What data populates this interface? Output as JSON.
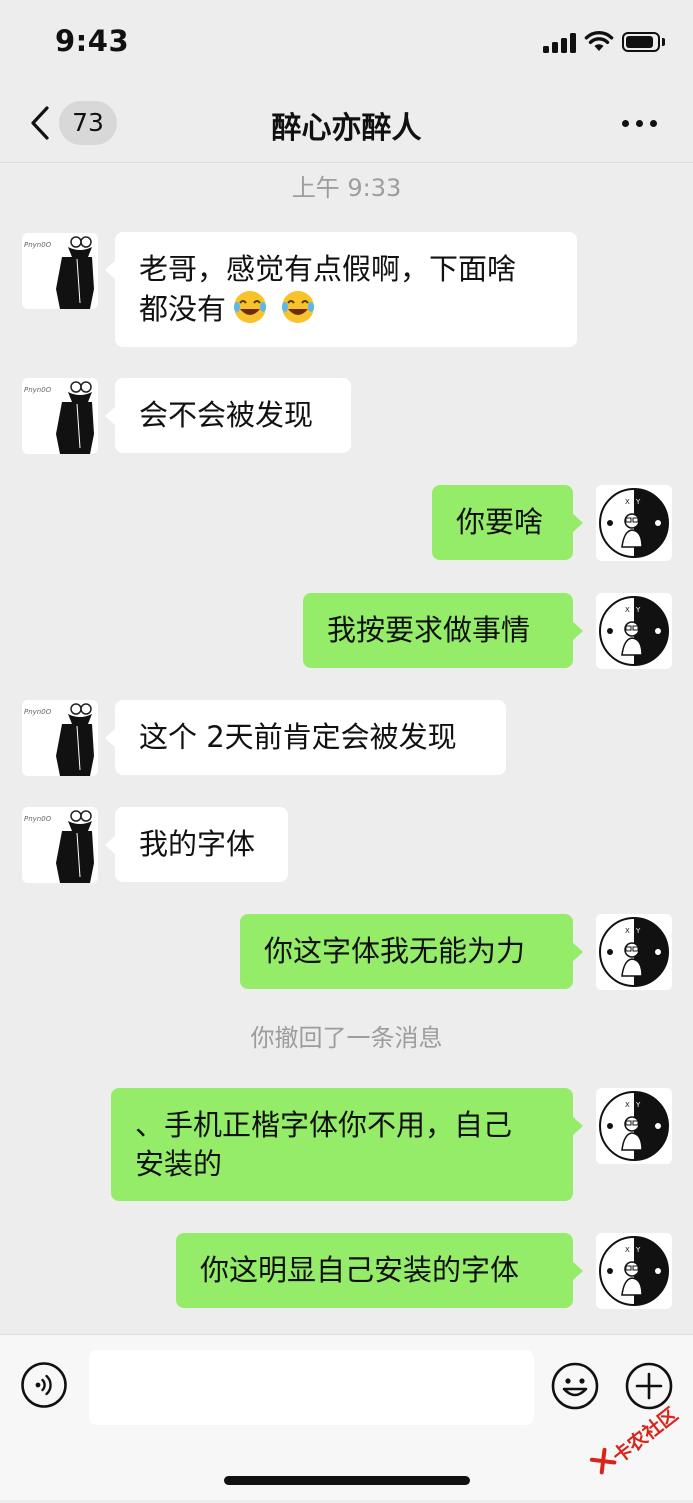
{
  "status_bar": {
    "time": "9:43"
  },
  "nav": {
    "unread_count": "73",
    "title": "醉心亦醉人"
  },
  "messages": [
    {
      "kind": "time",
      "text": "上午 9:33"
    },
    {
      "kind": "in",
      "text": "老哥，感觉有点假啊，下面啥",
      "text_line2": "都没有",
      "emojis": [
        "face-with-tears-of-joy",
        "face-with-tears-of-joy"
      ]
    },
    {
      "kind": "in",
      "text": "会不会被发现"
    },
    {
      "kind": "out",
      "text": "你要啥"
    },
    {
      "kind": "out",
      "text": "我按要求做事情"
    },
    {
      "kind": "in",
      "text": "这个 2天前肯定会被发现"
    },
    {
      "kind": "in",
      "text": "我的字体"
    },
    {
      "kind": "out",
      "text": "你这字体我无能为力"
    },
    {
      "kind": "system",
      "text": "你撤回了一条消息"
    },
    {
      "kind": "out",
      "text": "、手机正楷字体你不用，自己",
      "text_line2": "安装的"
    },
    {
      "kind": "out",
      "text": "你这明显自己安装的字体"
    }
  ],
  "avatars": {
    "contact": "contact-avatar",
    "self": "self-avatar",
    "self_letters": "X Y",
    "contact_signature": "Pnyn0O"
  },
  "watermark": {
    "text": "卡农社区"
  },
  "colors": {
    "background": "#ededed",
    "outgoing_bubble": "#95ec69",
    "incoming_bubble": "#ffffff",
    "input_bar": "#f7f7f7",
    "watermark": "#d9241b"
  }
}
